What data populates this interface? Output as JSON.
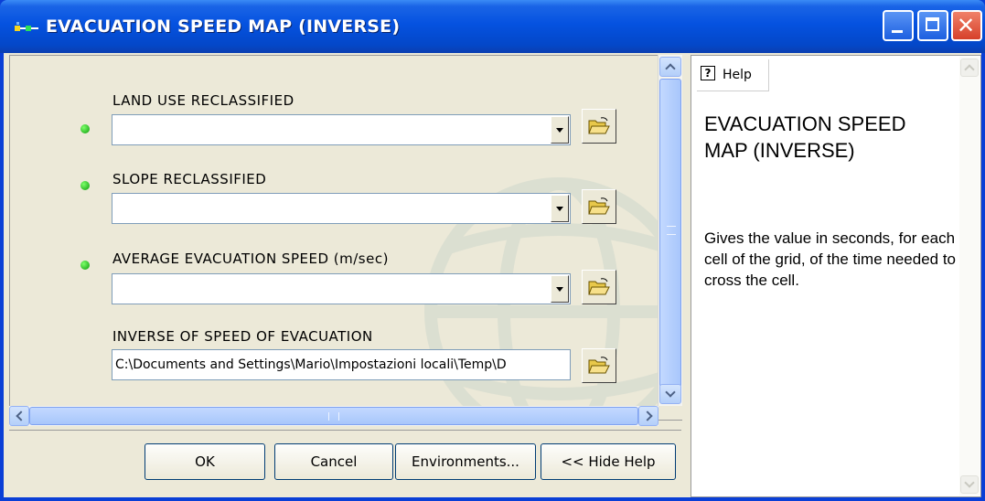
{
  "window": {
    "title": "EVACUATION SPEED MAP (INVERSE)",
    "controls": {
      "minimize": "minimize-icon",
      "maximize": "maximize-icon",
      "close": "close-icon"
    }
  },
  "params": [
    {
      "label": "LAND USE RECLASSIFIED",
      "value": "",
      "required": true
    },
    {
      "label": "SLOPE RECLASSIFIED",
      "value": "",
      "required": true
    },
    {
      "label": "AVERAGE EVACUATION SPEED (m/sec)",
      "value": "",
      "required": true
    },
    {
      "label": "INVERSE OF SPEED OF EVACUATION",
      "value": "C:\\Documents and Settings\\Mario\\Impostazioni locali\\Temp\\D",
      "required": false
    }
  ],
  "buttons": {
    "ok": "OK",
    "cancel": "Cancel",
    "environments": "Environments...",
    "hide_help": "<< Hide Help"
  },
  "help": {
    "tab_label": "Help",
    "title": "EVACUATION SPEED MAP (INVERSE)",
    "body": "Gives the value in seconds, for each cell of the grid, of the time needed to cross the cell."
  },
  "colors": {
    "titlebar": "#0552e0",
    "dialog_bg": "#ece9d8",
    "required_dot": "#0a9a0a"
  }
}
